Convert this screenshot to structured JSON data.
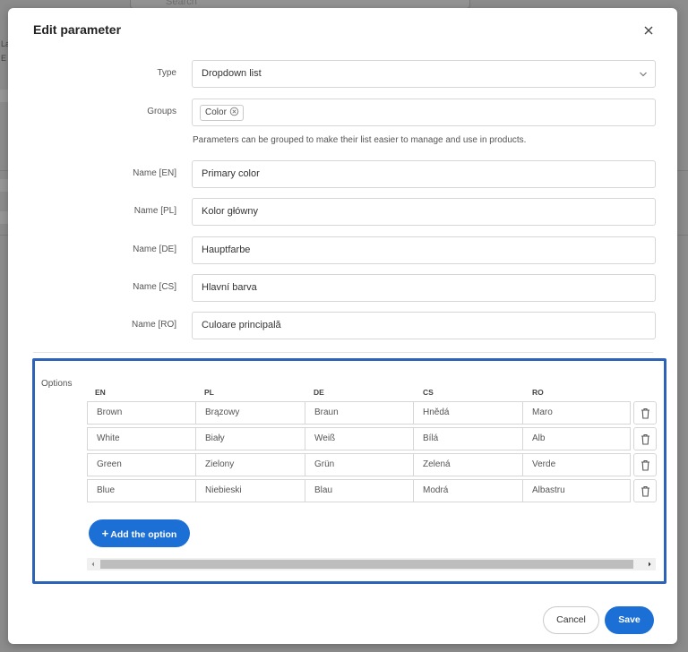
{
  "background": {
    "search_placeholder": "Search",
    "frag_1": "La",
    "frag_2": "E"
  },
  "modal": {
    "title": "Edit parameter",
    "close_icon": "close-icon"
  },
  "form": {
    "type": {
      "label": "Type",
      "value": "Dropdown list"
    },
    "groups": {
      "label": "Groups",
      "chip": "Color",
      "hint": "Parameters can be grouped to make their list easier to manage and use in products."
    },
    "names": [
      {
        "label": "Name [EN]",
        "value": "Primary color"
      },
      {
        "label": "Name [PL]",
        "value": "Kolor główny"
      },
      {
        "label": "Name [DE]",
        "value": "Hauptfarbe"
      },
      {
        "label": "Name [CS]",
        "value": "Hlavní barva"
      },
      {
        "label": "Name [RO]",
        "value": "Culoare principală"
      }
    ]
  },
  "options": {
    "label": "Options",
    "columns": [
      "EN",
      "PL",
      "DE",
      "CS",
      "RO"
    ],
    "rows": [
      [
        "Brown",
        "Brązowy",
        "Braun",
        "Hnědá",
        "Maro"
      ],
      [
        "White",
        "Biały",
        "Weiß",
        "Bílá",
        "Alb"
      ],
      [
        "Green",
        "Zielony",
        "Grün",
        "Zelená",
        "Verde"
      ],
      [
        "Blue",
        "Niebieski",
        "Blau",
        "Modrá",
        "Albastru"
      ]
    ],
    "add_label": "Add the option"
  },
  "footer": {
    "cancel_label": "Cancel",
    "save_label": "Save"
  },
  "colors": {
    "accent": "#1c6fd4",
    "highlight_border": "#2c62b8"
  }
}
